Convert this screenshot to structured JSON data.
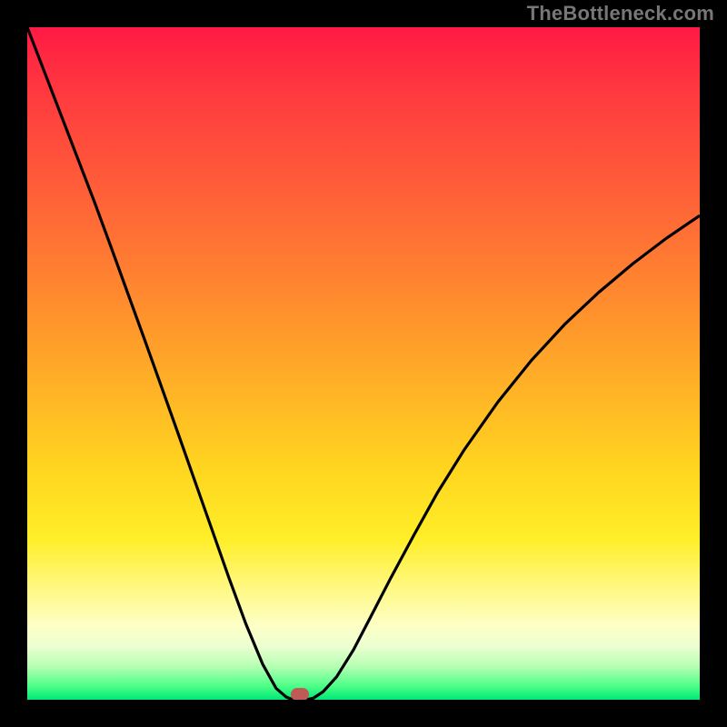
{
  "watermark": "TheBottleneck.com",
  "colors": {
    "frame_bg": "#000000",
    "gradient_top": "#ff1a44",
    "gradient_bottom": "#00e876",
    "curve_stroke": "#000000",
    "marker_fill": "#c05a56"
  },
  "chart_data": {
    "type": "line",
    "title": "",
    "xlabel": "",
    "ylabel": "",
    "xlim": [
      0,
      1
    ],
    "ylim": [
      0,
      1
    ],
    "x": [
      0.0,
      0.025,
      0.05,
      0.075,
      0.1,
      0.125,
      0.15,
      0.175,
      0.2,
      0.225,
      0.25,
      0.275,
      0.3,
      0.325,
      0.35,
      0.37,
      0.385,
      0.395,
      0.405,
      0.415,
      0.425,
      0.44,
      0.46,
      0.485,
      0.51,
      0.54,
      0.575,
      0.61,
      0.65,
      0.7,
      0.75,
      0.8,
      0.85,
      0.9,
      0.95,
      1.0
    ],
    "y": [
      1.0,
      0.935,
      0.87,
      0.805,
      0.74,
      0.672,
      0.603,
      0.534,
      0.464,
      0.394,
      0.323,
      0.252,
      0.181,
      0.113,
      0.053,
      0.017,
      0.004,
      0.0,
      0.0,
      0.0,
      0.002,
      0.012,
      0.034,
      0.074,
      0.122,
      0.18,
      0.245,
      0.308,
      0.372,
      0.443,
      0.505,
      0.559,
      0.606,
      0.648,
      0.686,
      0.72
    ],
    "minimum_point": {
      "x": 0.405,
      "y": 0.0
    },
    "background_gradient_axis": "vertical",
    "background_gradient_stops": [
      {
        "pos": 0.0,
        "color": "#ff1a44"
      },
      {
        "pos": 0.4,
        "color": "#ff8a2e"
      },
      {
        "pos": 0.66,
        "color": "#ffd61f"
      },
      {
        "pos": 0.89,
        "color": "#fdffc6"
      },
      {
        "pos": 1.0,
        "color": "#00e876"
      }
    ]
  }
}
